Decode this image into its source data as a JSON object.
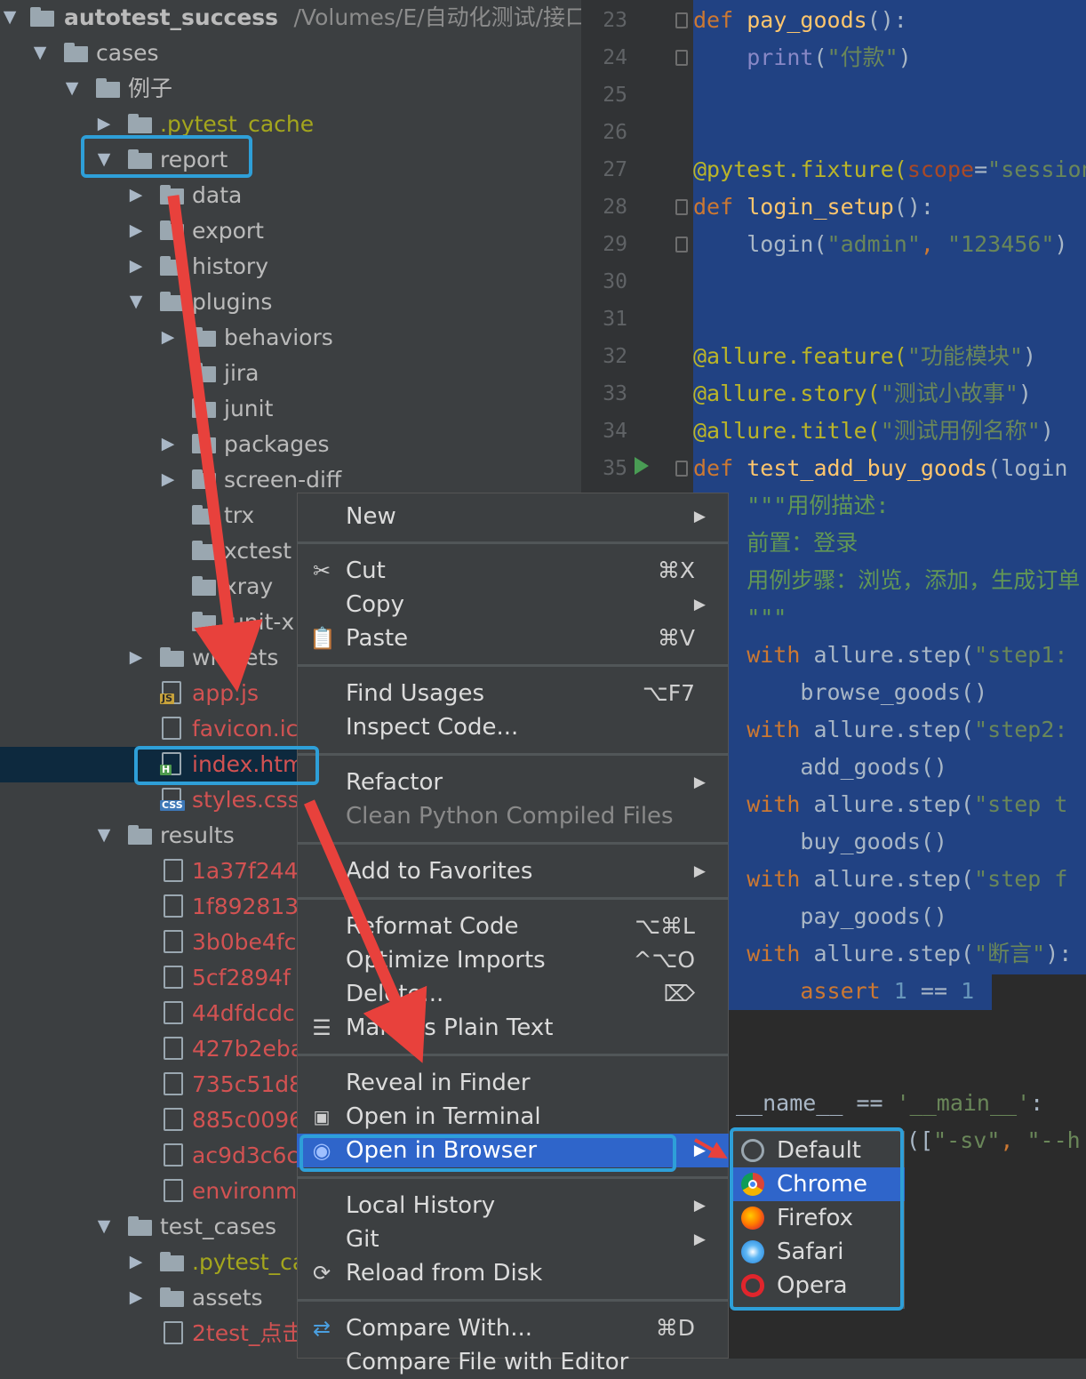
{
  "project_tree": {
    "root": {
      "label": "autotest_success",
      "path": "/Volumes/E/自动化测试/接口"
    },
    "items": [
      {
        "label": "cases"
      },
      {
        "label": "例子"
      },
      {
        "label": ".pytest_cache"
      },
      {
        "label": "report"
      },
      {
        "label": "data"
      },
      {
        "label": "export"
      },
      {
        "label": "history"
      },
      {
        "label": "plugins"
      },
      {
        "label": "behaviors"
      },
      {
        "label": "jira"
      },
      {
        "label": "junit"
      },
      {
        "label": "packages"
      },
      {
        "label": "screen-diff"
      },
      {
        "label": "trx"
      },
      {
        "label": "xctest"
      },
      {
        "label": "xray"
      },
      {
        "label": "junit-x"
      },
      {
        "label": "widgets"
      },
      {
        "label": "app.js",
        "tag": "JS"
      },
      {
        "label": "favicon.ico"
      },
      {
        "label": "index.html",
        "tag": "H"
      },
      {
        "label": "styles.css",
        "tag": "CSS"
      },
      {
        "label": "results"
      },
      {
        "label": "1a37f244"
      },
      {
        "label": "1f892813"
      },
      {
        "label": "3b0be4fc"
      },
      {
        "label": "5cf2894f"
      },
      {
        "label": "44dfdcdc"
      },
      {
        "label": "427b2eba"
      },
      {
        "label": "735c51d8"
      },
      {
        "label": "885c0096"
      },
      {
        "label": "ac9d3c6c"
      },
      {
        "label": "environment"
      },
      {
        "label": "test_cases"
      },
      {
        "label": ".pytest_cache"
      },
      {
        "label": "assets"
      },
      {
        "label": "2test_点击"
      }
    ]
  },
  "editor": {
    "line_numbers": [
      "23",
      "24",
      "25",
      "26",
      "27",
      "28",
      "29",
      "30",
      "31",
      "32",
      "33",
      "34",
      "35"
    ],
    "lines": [
      {
        "a": "def ",
        "b": "pay_goods",
        "c": "():"
      },
      {
        "a": "    ",
        "b": "print",
        "c": "(",
        "d": "\"付款\"",
        "e": ")"
      },
      {
        "a": "@pytest.fixture(",
        "b": "scope",
        "c": "=",
        "d": "\"session\"",
        "e": ")"
      },
      {
        "a": "def ",
        "b": "login_setup",
        "c": "():"
      },
      {
        "a": "    login(",
        "b": "\"admin\"",
        "c": ", ",
        "d": "\"123456\"",
        "e": ")"
      },
      {
        "a": "@allure.feature(",
        "b": "\"功能模块\"",
        "c": ")"
      },
      {
        "a": "@allure.story(",
        "b": "\"测试小故事\"",
        "c": ")"
      },
      {
        "a": "@allure.title(",
        "b": "\"测试用例名称\"",
        "c": ")"
      },
      {
        "a": "def ",
        "b": "test_add_buy_goods",
        "c": "(login"
      },
      {
        "a": "    \"\"\"用例描述:"
      },
      {
        "a": "    前置：登录"
      },
      {
        "a": "    用例步骤：浏览，添加，生成订单"
      },
      {
        "a": "    \"\"\""
      },
      {
        "a": "    with ",
        "b": "allure.step(",
        "c": "\"step1:"
      },
      {
        "a": "        browse_goods()"
      },
      {
        "a": "    with ",
        "b": "allure.step(",
        "c": "\"step2:"
      },
      {
        "a": "        add_goods()"
      },
      {
        "a": "    with ",
        "b": "allure.step(",
        "c": "\"step t"
      },
      {
        "a": "        buy_goods()"
      },
      {
        "a": "    with ",
        "b": "allure.step(",
        "c": "\"step f"
      },
      {
        "a": "        pay_goods()"
      },
      {
        "a": "    with ",
        "b": "allure.step(",
        "c": "\"断言\"",
        "d": "):"
      },
      {
        "a": "        assert ",
        "b": "1",
        "c": " == ",
        "d": "1"
      },
      {
        "a": "__name__ == ",
        "b": "'__main__'",
        "c": ":"
      },
      {
        "a": "([",
        "b": "\"-sv\"",
        "c": ", ",
        "d": "\"--h"
      }
    ]
  },
  "context_menu": {
    "items": [
      {
        "label": "New",
        "submenu": true
      },
      {
        "label": "Cut",
        "shortcut": "⌘X",
        "icon": "scissors-icon"
      },
      {
        "label": "Copy",
        "submenu": true
      },
      {
        "label": "Paste",
        "shortcut": "⌘V",
        "icon": "clipboard-icon"
      },
      {
        "label": "Find Usages",
        "shortcut": "⌥F7"
      },
      {
        "label": "Inspect Code..."
      },
      {
        "label": "Refactor",
        "submenu": true
      },
      {
        "label": "Clean Python Compiled Files",
        "disabled": true
      },
      {
        "label": "Add to Favorites",
        "submenu": true
      },
      {
        "label": "Reformat Code",
        "shortcut": "⌥⌘L"
      },
      {
        "label": "Optimize Imports",
        "shortcut": "^⌥O"
      },
      {
        "label": "Delete...",
        "shortcut": "⌦"
      },
      {
        "label": "Mark as Plain Text",
        "icon": "plain-text-icon"
      },
      {
        "label": "Reveal in Finder"
      },
      {
        "label": "Open in Terminal",
        "icon": "terminal-icon"
      },
      {
        "label": "Open in Browser",
        "submenu": true,
        "icon": "globe-icon",
        "highlighted": true
      },
      {
        "label": "Local History",
        "submenu": true
      },
      {
        "label": "Git",
        "submenu": true
      },
      {
        "label": "Reload from Disk",
        "icon": "reload-icon"
      },
      {
        "label": "Compare With...",
        "shortcut": "⌘D",
        "icon": "compare-icon"
      },
      {
        "label": "Compare File with Editor"
      }
    ]
  },
  "browser_submenu": {
    "items": [
      {
        "label": "Default",
        "icon": "globe-icon"
      },
      {
        "label": "Chrome",
        "icon": "chrome-icon",
        "highlighted": true
      },
      {
        "label": "Firefox",
        "icon": "firefox-icon"
      },
      {
        "label": "Safari",
        "icon": "safari-icon"
      },
      {
        "label": "Opera",
        "icon": "opera-icon"
      }
    ]
  },
  "colors": {
    "annotation_box": "#2e9fd8",
    "annotation_arrow": "#e8413c",
    "highlight": "#2f65ca",
    "selection": "#214283"
  }
}
